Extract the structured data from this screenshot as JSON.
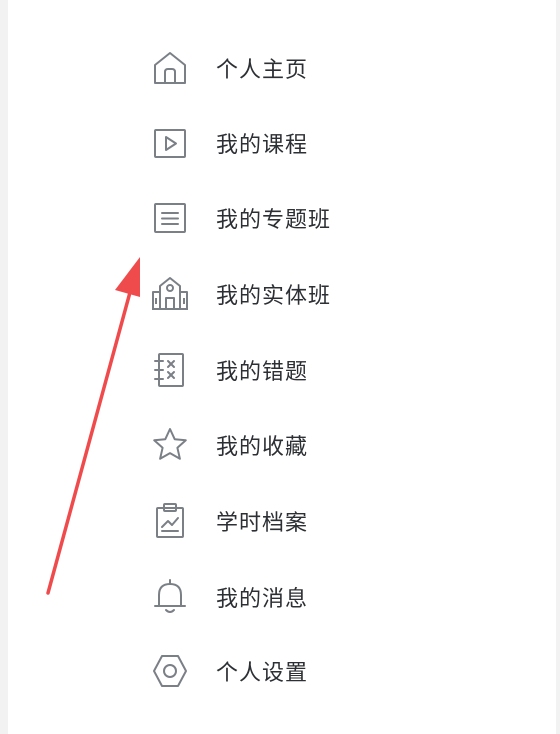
{
  "menu": {
    "items": [
      {
        "label": "个人主页",
        "icon": "home-icon"
      },
      {
        "label": "我的课程",
        "icon": "play-video-icon"
      },
      {
        "label": "我的专题班",
        "icon": "document-list-icon"
      },
      {
        "label": "我的实体班",
        "icon": "school-building-icon"
      },
      {
        "label": "我的错题",
        "icon": "wrong-questions-icon"
      },
      {
        "label": "我的收藏",
        "icon": "star-icon"
      },
      {
        "label": "学时档案",
        "icon": "clipboard-chart-icon"
      },
      {
        "label": "我的消息",
        "icon": "bell-icon"
      },
      {
        "label": "个人设置",
        "icon": "gear-icon"
      }
    ]
  },
  "colors": {
    "icon_stroke": "#7b8087",
    "label_text": "#2c2f33",
    "arrow": "#f04b4c",
    "background": "#f2f2f3",
    "panel": "#ffffff"
  }
}
